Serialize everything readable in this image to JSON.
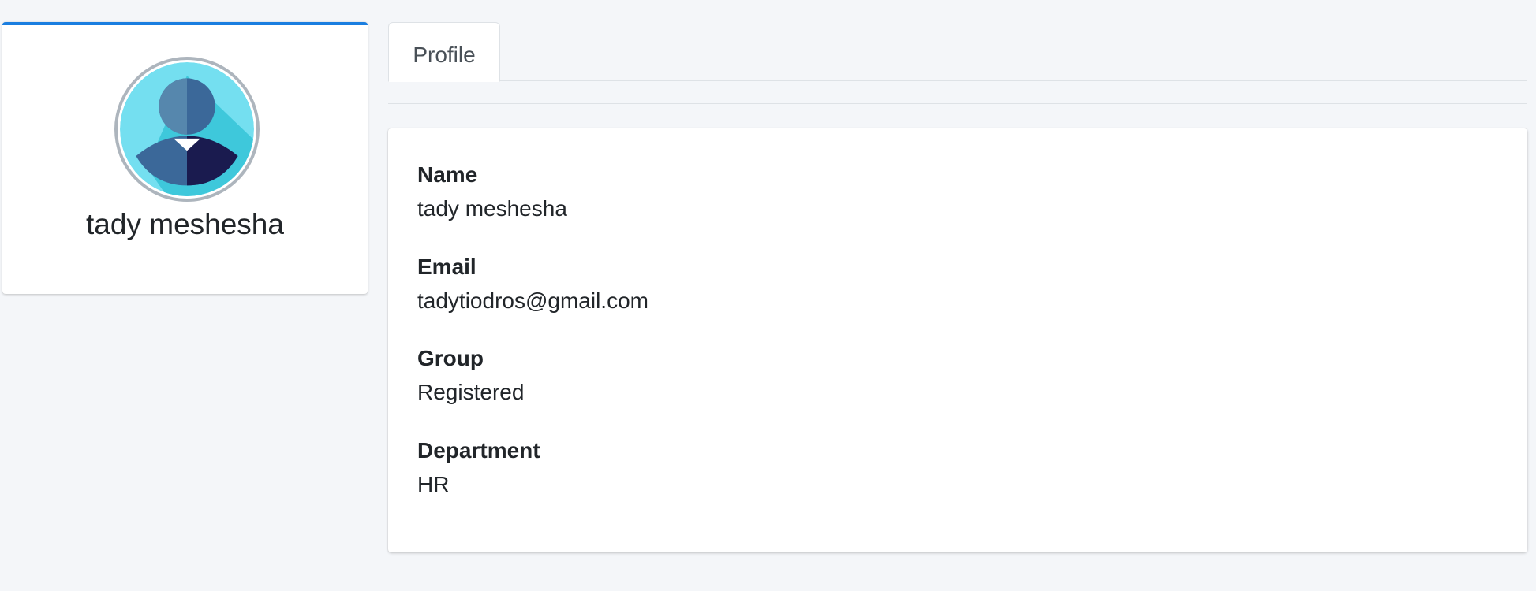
{
  "user": {
    "display_name": "tady meshesha"
  },
  "tabs": [
    {
      "label": "Profile"
    }
  ],
  "fields": [
    {
      "label": "Name",
      "value": "tady meshesha"
    },
    {
      "label": "Email",
      "value": "tadytiodros@gmail.com"
    },
    {
      "label": "Group",
      "value": "Registered"
    },
    {
      "label": "Department",
      "value": "HR"
    }
  ],
  "colors": {
    "accent": "#1a7ee0",
    "page_background": "#f4f6f9",
    "avatar_background": "#74dff0",
    "avatar_suit": "#3b6899",
    "avatar_dark": "#1a1b4f"
  },
  "icons": {
    "avatar": "user-avatar-icon"
  }
}
